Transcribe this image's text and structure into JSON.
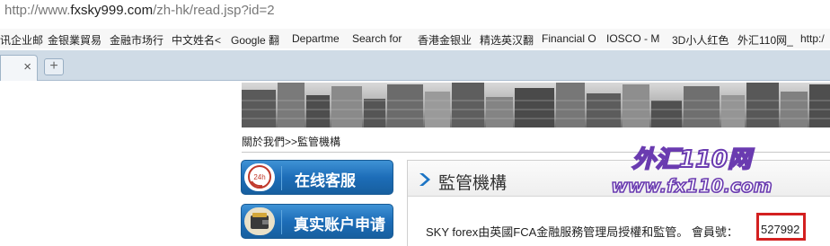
{
  "address_bar": {
    "url_prefix": "http://www.",
    "url_host": "fxsky999.com",
    "url_path": "/zh-hk/read.jsp?id=2"
  },
  "bookmarks": [
    "讯企业邮",
    "金银業貿易",
    "金融市场行",
    "中文姓名<",
    "Google 翻",
    "Departme",
    "Search for",
    "香港金银业",
    "精选英汉翻",
    "Financial O",
    "IOSCO - M",
    "3D小人红色",
    "外汇110网_",
    "http:/"
  ],
  "tabs": {
    "close_glyph": "×",
    "new_tab_glyph": "+"
  },
  "breadcrumb": "關於我們>>監管機構",
  "sidebar_buttons": [
    {
      "label": "在线客服",
      "icon_text": "24h"
    },
    {
      "label": "真实账户申请"
    }
  ],
  "panel": {
    "title": "監管機構"
  },
  "statement": {
    "text": "SKY forex由英國FCA金融服務管理局授權和監管。 會員號：",
    "member_number": "527992"
  },
  "watermark": {
    "line1": "外汇110网",
    "line2": "www.fx110.com"
  },
  "colors": {
    "button_blue": "#1d6db8",
    "highlight_red": "#d32020",
    "watermark_purple": "#6a3bb0"
  }
}
